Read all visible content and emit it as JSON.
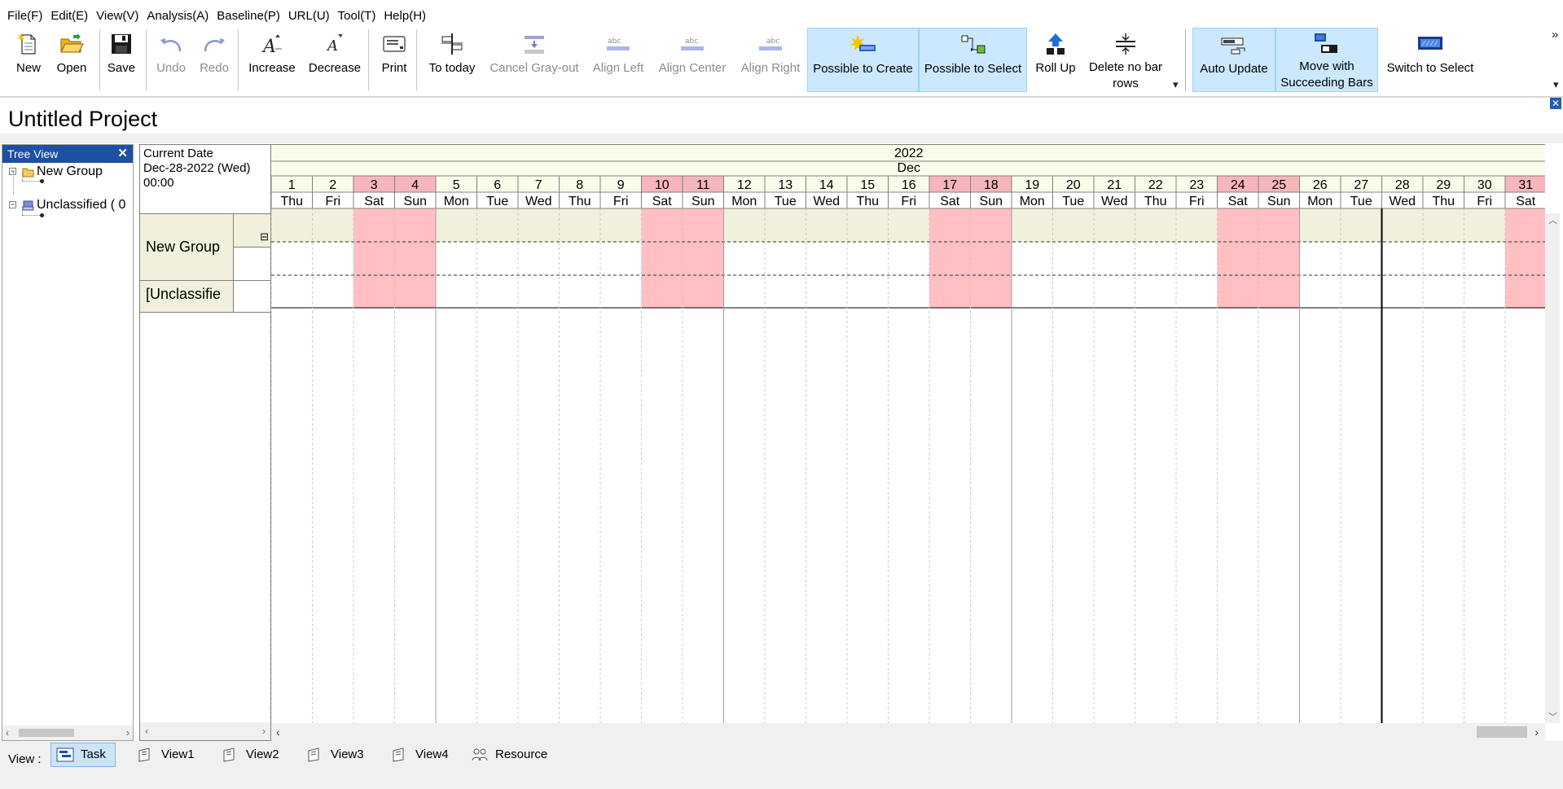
{
  "menu": [
    "File(F)",
    "Edit(E)",
    "View(V)",
    "Analysis(A)",
    "Baseline(P)",
    "URL(U)",
    "Tool(T)",
    "Help(H)"
  ],
  "toolbar": {
    "new": "New",
    "open": "Open",
    "save": "Save",
    "undo": "Undo",
    "redo": "Redo",
    "increase": "Increase",
    "decrease": "Decrease",
    "print": "Print",
    "to_today": "To today",
    "cancel_grayout": "Cancel Gray-out",
    "align_left": "Align Left",
    "align_center": "Align Center",
    "align_right": "Align Right",
    "possible_to_create": "Possible to Create",
    "possible_to_select": "Possible to Select",
    "roll_up": "Roll Up",
    "delete_no_bar_rows_1": "Delete no bar",
    "delete_no_bar_rows_2": "rows",
    "auto_update": "Auto Update",
    "move_with_succeeding_1": "Move with",
    "move_with_succeeding_2": "Succeeding Bars",
    "switch_to_select": "Switch to Select",
    "overflow": "»"
  },
  "project_title": "Untitled Project",
  "tree": {
    "header": "Tree View",
    "close": "✕",
    "items": [
      "New Group",
      "Unclassified ( 0"
    ]
  },
  "current_date": {
    "label": "Current Date",
    "date": "Dec-28-2022 (Wed)",
    "time": "00:00"
  },
  "rows": {
    "group1": "New Group",
    "group2": "[Unclassifie",
    "collapse": "⊟"
  },
  "timeline": {
    "year": "2022",
    "month": "Dec",
    "today_day": 28,
    "days": [
      {
        "d": "1",
        "w": "Thu",
        "off": false
      },
      {
        "d": "2",
        "w": "Fri",
        "off": false
      },
      {
        "d": "3",
        "w": "Sat",
        "off": true
      },
      {
        "d": "4",
        "w": "Sun",
        "off": true
      },
      {
        "d": "5",
        "w": "Mon",
        "off": false
      },
      {
        "d": "6",
        "w": "Tue",
        "off": false
      },
      {
        "d": "7",
        "w": "Wed",
        "off": false
      },
      {
        "d": "8",
        "w": "Thu",
        "off": false
      },
      {
        "d": "9",
        "w": "Fri",
        "off": false
      },
      {
        "d": "10",
        "w": "Sat",
        "off": true
      },
      {
        "d": "11",
        "w": "Sun",
        "off": true
      },
      {
        "d": "12",
        "w": "Mon",
        "off": false
      },
      {
        "d": "13",
        "w": "Tue",
        "off": false
      },
      {
        "d": "14",
        "w": "Wed",
        "off": false
      },
      {
        "d": "15",
        "w": "Thu",
        "off": false
      },
      {
        "d": "16",
        "w": "Fri",
        "off": false
      },
      {
        "d": "17",
        "w": "Sat",
        "off": true
      },
      {
        "d": "18",
        "w": "Sun",
        "off": true
      },
      {
        "d": "19",
        "w": "Mon",
        "off": false
      },
      {
        "d": "20",
        "w": "Tue",
        "off": false
      },
      {
        "d": "21",
        "w": "Wed",
        "off": false
      },
      {
        "d": "22",
        "w": "Thu",
        "off": false
      },
      {
        "d": "23",
        "w": "Fri",
        "off": false
      },
      {
        "d": "24",
        "w": "Sat",
        "off": true
      },
      {
        "d": "25",
        "w": "Sun",
        "off": true
      },
      {
        "d": "26",
        "w": "Mon",
        "off": false
      },
      {
        "d": "27",
        "w": "Tue",
        "off": false
      },
      {
        "d": "28",
        "w": "Wed",
        "off": false
      },
      {
        "d": "29",
        "w": "Thu",
        "off": false
      },
      {
        "d": "30",
        "w": "Fri",
        "off": false
      },
      {
        "d": "31",
        "w": "Sat",
        "off": true
      }
    ]
  },
  "colors": {
    "weekend": "#ffbfc3",
    "weekend_header": "#f6b6bb",
    "header_bg": "#fbfbe9",
    "group_row": "#f1f0dc",
    "selection": "#cce8ff",
    "tree_header": "#1d4fa3"
  },
  "viewbar": {
    "label": "View :",
    "tabs": [
      "Task",
      "View1",
      "View2",
      "View3",
      "View4",
      "Resource"
    ]
  }
}
